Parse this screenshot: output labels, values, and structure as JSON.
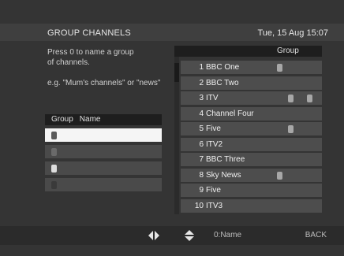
{
  "header": {
    "title": "GROUP CHANNELS",
    "datetime": "Tue, 15 Aug  15:07"
  },
  "help": {
    "line1": "Press 0 to name a group",
    "line2": "of channels.",
    "example": "e.g. \"Mum's channels\" or \"news\""
  },
  "groups": {
    "header_group": "Group",
    "header_name": "Name",
    "rows": [
      {
        "swatch_color": "#5a5a5a",
        "selected": true
      },
      {
        "swatch_color": "#6a6a6a"
      },
      {
        "swatch_color": "#dddddd"
      },
      {
        "swatch_color": "#3a3a3a"
      }
    ]
  },
  "channels": {
    "header_group": "Group",
    "items": [
      {
        "num": "1",
        "name": "BBC One",
        "markers": [
          "m1"
        ]
      },
      {
        "num": "2",
        "name": "BBC Two",
        "markers": []
      },
      {
        "num": "3",
        "name": "ITV",
        "markers": [
          "m2",
          "m3"
        ]
      },
      {
        "num": "4",
        "name": "Channel Four",
        "markers": []
      },
      {
        "num": "5",
        "name": "Five",
        "markers": [
          "m2"
        ]
      },
      {
        "num": "6",
        "name": "ITV2",
        "markers": []
      },
      {
        "num": "7",
        "name": "BBC Three",
        "markers": []
      },
      {
        "num": "8",
        "name": "Sky News",
        "markers": [
          "m1"
        ]
      },
      {
        "num": "9",
        "name": "Five",
        "markers": []
      },
      {
        "num": "10",
        "name": "ITV3",
        "markers": []
      }
    ]
  },
  "footer": {
    "hint": "0:Name",
    "back": "BACK",
    "lr_icon": "left-right-arrows-icon",
    "ud_icon": "up-down-arrows-icon"
  }
}
